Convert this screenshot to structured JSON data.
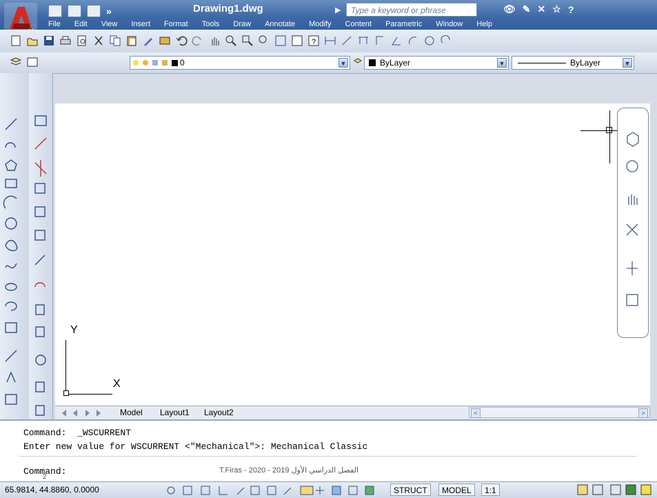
{
  "window": {
    "title": "Drawing1.dwg",
    "search_placeholder": "Type a keyword or phrase",
    "accent": "#3e6aa8"
  },
  "menus": [
    "File",
    "Edit",
    "View",
    "Insert",
    "Format",
    "Tools",
    "Draw",
    "Annotate",
    "Modify",
    "Content",
    "Parametric",
    "Window",
    "Help"
  ],
  "toolbar": {
    "layer_value": "0",
    "color_value": "ByLayer",
    "linetype_value": "ByLayer"
  },
  "canvas": {
    "ucs_y": "Y",
    "ucs_x": "X",
    "tabs": [
      "Model",
      "Layout1",
      "Layout2"
    ]
  },
  "command": {
    "line1": "Command:  _WSCURRENT",
    "line2": "Enter new value for WSCURRENT <\"Mechanical\">: Mechanical Classic",
    "prompt": "Command:"
  },
  "status": {
    "coords": "65.9814, 44.8860, 0.0000",
    "struct": "STRUCT",
    "model": "MODEL",
    "scale": "1:1"
  },
  "overlay": {
    "footer": "T.Firas  -  2020 - 2019 الفصل الدراسي الأول",
    "page_number": "2"
  }
}
